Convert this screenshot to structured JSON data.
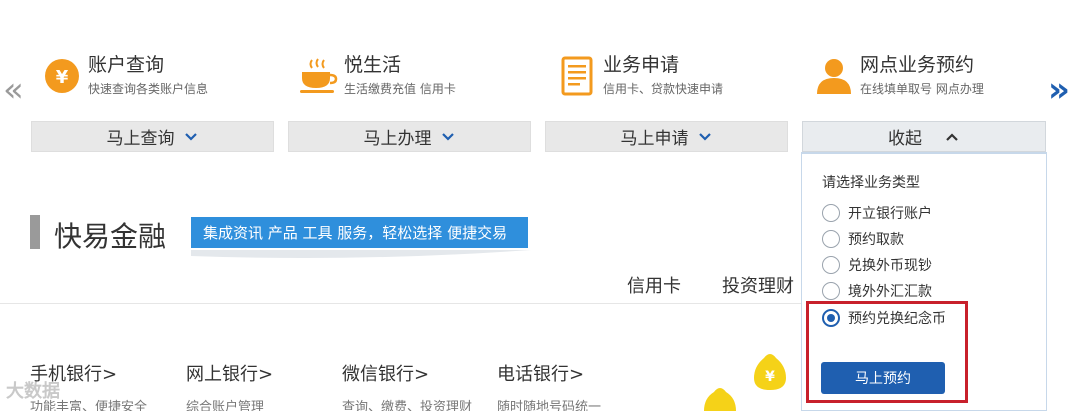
{
  "carousel": {
    "prev_icon": "chevron-left-icon",
    "next_icon": "chevron-right-icon",
    "prev_glyph": "«",
    "next_glyph": "»"
  },
  "services": [
    {
      "icon": "yen-coin-icon",
      "title": "账户查询",
      "desc": "快速查询各类账户信息",
      "button": "马上查询"
    },
    {
      "icon": "coffee-cup-icon",
      "title": "悦生活",
      "desc": "生活缴费充值 信用卡",
      "button": "马上办理"
    },
    {
      "icon": "document-icon",
      "title": "业务申请",
      "desc": "信用卡、贷款快速申请",
      "button": "马上申请"
    },
    {
      "icon": "person-icon",
      "title": "网点业务预约",
      "desc": "在线填单取号 网点办理",
      "button": "收起"
    }
  ],
  "dropdown": {
    "prompt": "请选择业务类型",
    "options": [
      {
        "label": "开立银行账户",
        "checked": false
      },
      {
        "label": "预约取款",
        "checked": false
      },
      {
        "label": "兑换外币现钞",
        "checked": false
      },
      {
        "label": "境外外汇汇款",
        "checked": false
      },
      {
        "label": "预约兑换纪念币",
        "checked": true
      }
    ],
    "submit": "马上预约"
  },
  "section": {
    "title": "快易金融",
    "tag": "集成资讯 产品 工具 服务，轻松选择 便捷交易"
  },
  "tabs": [
    "信用卡",
    "投资理财"
  ],
  "channels": [
    {
      "title": "手机银行>",
      "desc": "功能丰富、便捷安全"
    },
    {
      "title": "网上银行>",
      "desc": "综合账户管理"
    },
    {
      "title": "微信银行>",
      "desc": "查询、缴费、投资理财"
    },
    {
      "title": "电话银行>",
      "desc": "随时随地号码统一"
    }
  ],
  "watermark": "大数据",
  "colors": {
    "accent_blue": "#1f5fb0",
    "tag_blue": "#2f8fdc",
    "icon_orange": "#f39a1e",
    "highlight_red": "#c8202b",
    "button_gray": "#e8e8e8"
  }
}
